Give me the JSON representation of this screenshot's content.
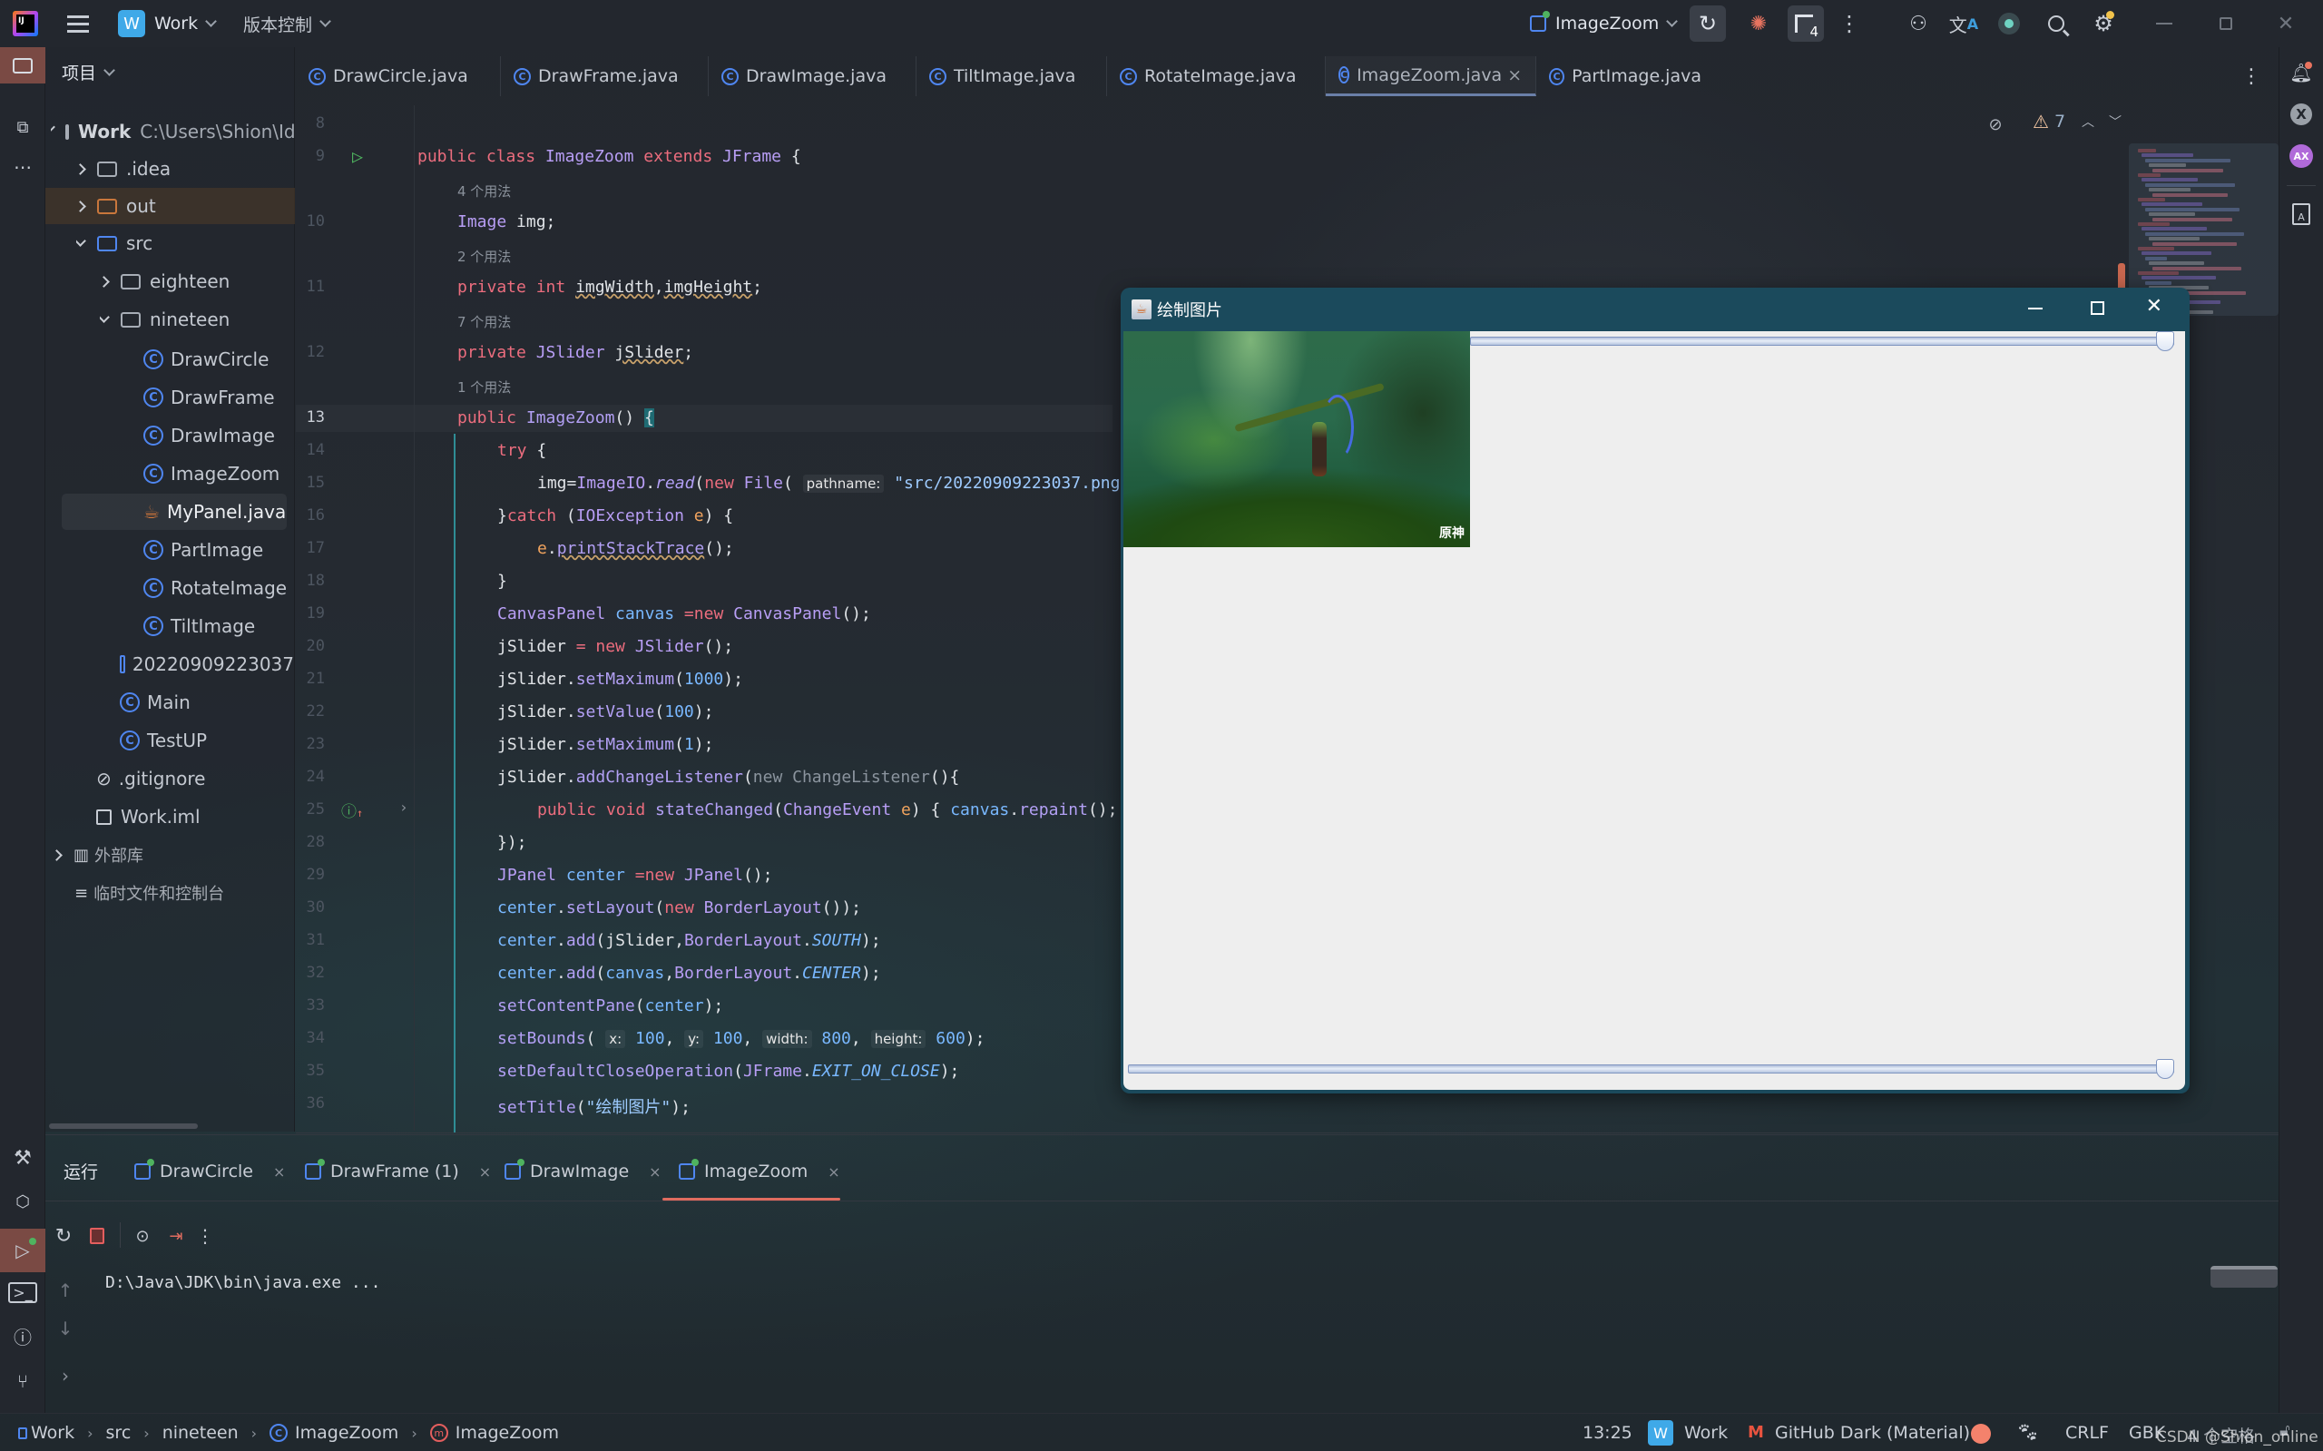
{
  "titlebar": {
    "project_badge": "W",
    "project_name": "Work",
    "vcs_menu": "版本控制",
    "run_config": "ImageZoom",
    "services_badge": "4"
  },
  "left_stripe": {
    "items": [
      "project-icon",
      "structure-icon",
      "more-icon"
    ]
  },
  "project_panel": {
    "title": "项目",
    "root": {
      "name": "Work",
      "path": "C:\\Users\\Shion\\Id"
    },
    "items": [
      {
        "label": ".idea",
        "type": "folder",
        "state": "collapsed"
      },
      {
        "label": "out",
        "type": "folder-excluded",
        "state": "collapsed"
      },
      {
        "label": "src",
        "type": "folder-source",
        "state": "expanded"
      },
      {
        "label": "eighteen",
        "type": "package",
        "state": "collapsed"
      },
      {
        "label": "nineteen",
        "type": "package",
        "state": "expanded"
      },
      {
        "label": "DrawCircle",
        "type": "class"
      },
      {
        "label": "DrawFrame",
        "type": "class"
      },
      {
        "label": "DrawImage",
        "type": "class"
      },
      {
        "label": "ImageZoom",
        "type": "class"
      },
      {
        "label": "MyPanel.java",
        "type": "java-file",
        "selected": true
      },
      {
        "label": "PartImage",
        "type": "class"
      },
      {
        "label": "RotateImage",
        "type": "class"
      },
      {
        "label": "TiltImage",
        "type": "class"
      },
      {
        "label": "20220909223037",
        "type": "image"
      },
      {
        "label": "Main",
        "type": "class"
      },
      {
        "label": "TestUP",
        "type": "class"
      },
      {
        "label": ".gitignore",
        "type": "ignore"
      },
      {
        "label": "Work.iml",
        "type": "module"
      },
      {
        "label": "外部库",
        "type": "libraries",
        "state": "collapsed"
      },
      {
        "label": "临时文件和控制台",
        "type": "scratches"
      }
    ]
  },
  "editor_tabs": [
    {
      "label": "DrawCircle.java"
    },
    {
      "label": "DrawFrame.java"
    },
    {
      "label": "DrawImage.java"
    },
    {
      "label": "TiltImage.java"
    },
    {
      "label": "RotateImage.java"
    },
    {
      "label": "ImageZoom.java",
      "active": true,
      "close": "×"
    },
    {
      "label": "PartImage.java"
    }
  ],
  "inspections": {
    "warnings": "7"
  },
  "code": {
    "usages": [
      "4 个用法",
      "2 个用法",
      "7 个用法",
      "1 个用法"
    ],
    "line_numbers": [
      "8",
      "9",
      "10",
      "11",
      "12",
      "13",
      "14",
      "15",
      "16",
      "17",
      "18",
      "19",
      "20",
      "21",
      "22",
      "23",
      "24",
      "25",
      "28",
      "29",
      "30",
      "31",
      "32",
      "33",
      "34",
      "35",
      "36"
    ],
    "current_line": "13",
    "param_hints": {
      "pathname": "pathname:",
      "x": "x:",
      "y": "y:",
      "width": "width:",
      "height": "height:"
    },
    "lines": {
      "l9": [
        "public",
        "class",
        "ImageZoom",
        "extends",
        "JFrame",
        "{"
      ],
      "l10": [
        "Image",
        "img;"
      ],
      "l11": [
        "private",
        "int",
        "imgWidth",
        ",",
        "imgHeight",
        ";"
      ],
      "l12": [
        "private",
        "JSlider",
        "jSlider",
        ";"
      ],
      "l13": [
        "public",
        "ImageZoom",
        "() ",
        "{"
      ],
      "l14": [
        "try",
        " {"
      ],
      "l15": [
        "img=",
        "ImageIO",
        ".",
        "read",
        "(",
        "new",
        " File",
        "( ",
        "\"src/20220909223037.png"
      ],
      "l16": [
        "}",
        "catch",
        " (",
        "IOException",
        " e",
        ") {"
      ],
      "l17": [
        "e",
        ".",
        "printStackTrace",
        "();"
      ],
      "l18": [
        "}"
      ],
      "l19": [
        "CanvasPanel",
        " canvas ",
        "=",
        "new",
        " CanvasPanel",
        "();"
      ],
      "l20": [
        "jSlider",
        " = ",
        "new",
        " JSlider",
        "();"
      ],
      "l21": [
        "jSlider.",
        "setMaximum",
        "(",
        "1000",
        ");"
      ],
      "l22": [
        "jSlider.",
        "setValue",
        "(",
        "100",
        ");"
      ],
      "l23": [
        "jSlider.",
        "setMaximum",
        "(",
        "1",
        ");"
      ],
      "l24": [
        "jSlider.",
        "addChangeListener",
        "(",
        "new ChangeListener",
        "(){"
      ],
      "l25": [
        "public",
        " void",
        " stateChanged",
        "(",
        "ChangeEvent",
        " e",
        ") { ",
        "canvas",
        ".",
        "repaint",
        "();"
      ],
      "l28": [
        "});"
      ],
      "l29": [
        "JPanel",
        " center ",
        "=",
        "new",
        " JPanel",
        "();"
      ],
      "l30": [
        "center",
        ".",
        "setLayout",
        "(",
        "new",
        " BorderLayout",
        "());"
      ],
      "l31": [
        "center",
        ".",
        "add",
        "(",
        "jSlider",
        ",",
        "BorderLayout",
        ".",
        "SOUTH",
        ");"
      ],
      "l32": [
        "center",
        ".",
        "add",
        "(",
        "canvas",
        ",",
        "BorderLayout",
        ".",
        "CENTER",
        ");"
      ],
      "l33": [
        "setContentPane",
        "(",
        "center",
        ");"
      ],
      "l34": [
        "setBounds",
        "( ",
        "100",
        ", ",
        "100",
        ", ",
        "800",
        ", ",
        "600",
        ");"
      ],
      "l35": [
        "setDefaultCloseOperation",
        "(",
        "JFrame",
        ".",
        "EXIT_ON_CLOSE",
        ");"
      ],
      "l36": [
        "setTitle",
        "(",
        "\"绘制图片\"",
        ");"
      ]
    }
  },
  "swing_window": {
    "title": "绘制图片",
    "image_caption": "原神",
    "slider_top_value": 1,
    "slider_top_max": 1,
    "slider_bottom_value": 1,
    "slider_bottom_max": 1
  },
  "run_panel": {
    "title": "运行",
    "tabs": [
      {
        "label": "DrawCircle"
      },
      {
        "label": "DrawFrame (1)"
      },
      {
        "label": "DrawImage"
      },
      {
        "label": "ImageZoom",
        "active": true
      }
    ],
    "close": "×",
    "console_output": "D:\\Java\\JDK\\bin\\java.exe ..."
  },
  "statusbar": {
    "breadcrumbs": [
      "Work",
      "src",
      "nineteen",
      "ImageZoom",
      "ImageZoom"
    ],
    "caret": "13:25",
    "project_badge": "W",
    "project": "Work",
    "theme": "GitHub Dark (Material)",
    "line_sep": "CRLF",
    "encoding": "GBK",
    "indent": "4 个空格",
    "watermark": "CSDN @Shion_online"
  },
  "colors": {
    "accent": "#4f86f0",
    "keyword": "#ec6d7e",
    "type": "#b89ef5",
    "number": "#79b8ff",
    "swing_title": "#1b4a5c",
    "run_tab_underline": "#e06c5f",
    "selection_stripe": "#7a4a44"
  }
}
